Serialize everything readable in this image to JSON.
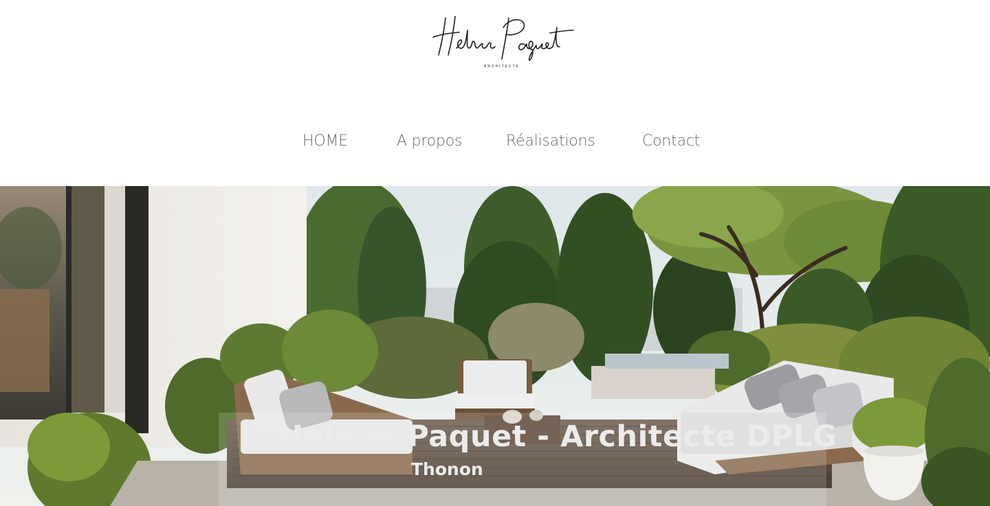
{
  "header": {
    "logo": {
      "name": "Helene Paquet",
      "subtitle": "ARCHITECTE"
    }
  },
  "nav": {
    "items": [
      {
        "label": "HOME"
      },
      {
        "label": "A propos"
      },
      {
        "label": "Réalisations"
      },
      {
        "label": "Contact"
      }
    ]
  },
  "hero": {
    "title": "Helene Paquet - Architecte DPLG",
    "subtitle": "Thonon"
  }
}
